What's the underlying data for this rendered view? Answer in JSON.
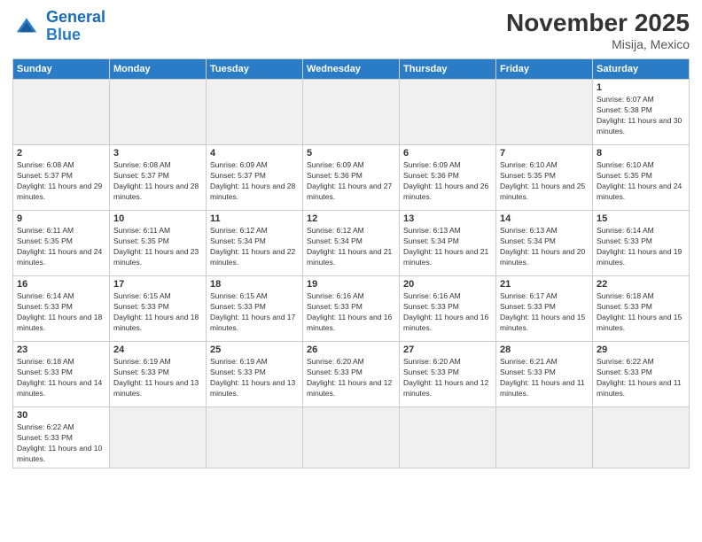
{
  "logo": {
    "text_general": "General",
    "text_blue": "Blue"
  },
  "header": {
    "month_year": "November 2025",
    "location": "Misija, Mexico"
  },
  "weekdays": [
    "Sunday",
    "Monday",
    "Tuesday",
    "Wednesday",
    "Thursday",
    "Friday",
    "Saturday"
  ],
  "weeks": [
    [
      {
        "day": "",
        "empty": true
      },
      {
        "day": "",
        "empty": true
      },
      {
        "day": "",
        "empty": true
      },
      {
        "day": "",
        "empty": true
      },
      {
        "day": "",
        "empty": true
      },
      {
        "day": "",
        "empty": true
      },
      {
        "day": "1",
        "sunrise": "Sunrise: 6:07 AM",
        "sunset": "Sunset: 5:38 PM",
        "daylight": "Daylight: 11 hours and 30 minutes."
      }
    ],
    [
      {
        "day": "2",
        "sunrise": "Sunrise: 6:08 AM",
        "sunset": "Sunset: 5:37 PM",
        "daylight": "Daylight: 11 hours and 29 minutes."
      },
      {
        "day": "3",
        "sunrise": "Sunrise: 6:08 AM",
        "sunset": "Sunset: 5:37 PM",
        "daylight": "Daylight: 11 hours and 28 minutes."
      },
      {
        "day": "4",
        "sunrise": "Sunrise: 6:09 AM",
        "sunset": "Sunset: 5:37 PM",
        "daylight": "Daylight: 11 hours and 28 minutes."
      },
      {
        "day": "5",
        "sunrise": "Sunrise: 6:09 AM",
        "sunset": "Sunset: 5:36 PM",
        "daylight": "Daylight: 11 hours and 27 minutes."
      },
      {
        "day": "6",
        "sunrise": "Sunrise: 6:09 AM",
        "sunset": "Sunset: 5:36 PM",
        "daylight": "Daylight: 11 hours and 26 minutes."
      },
      {
        "day": "7",
        "sunrise": "Sunrise: 6:10 AM",
        "sunset": "Sunset: 5:35 PM",
        "daylight": "Daylight: 11 hours and 25 minutes."
      },
      {
        "day": "8",
        "sunrise": "Sunrise: 6:10 AM",
        "sunset": "Sunset: 5:35 PM",
        "daylight": "Daylight: 11 hours and 24 minutes."
      }
    ],
    [
      {
        "day": "9",
        "sunrise": "Sunrise: 6:11 AM",
        "sunset": "Sunset: 5:35 PM",
        "daylight": "Daylight: 11 hours and 24 minutes."
      },
      {
        "day": "10",
        "sunrise": "Sunrise: 6:11 AM",
        "sunset": "Sunset: 5:35 PM",
        "daylight": "Daylight: 11 hours and 23 minutes."
      },
      {
        "day": "11",
        "sunrise": "Sunrise: 6:12 AM",
        "sunset": "Sunset: 5:34 PM",
        "daylight": "Daylight: 11 hours and 22 minutes."
      },
      {
        "day": "12",
        "sunrise": "Sunrise: 6:12 AM",
        "sunset": "Sunset: 5:34 PM",
        "daylight": "Daylight: 11 hours and 21 minutes."
      },
      {
        "day": "13",
        "sunrise": "Sunrise: 6:13 AM",
        "sunset": "Sunset: 5:34 PM",
        "daylight": "Daylight: 11 hours and 21 minutes."
      },
      {
        "day": "14",
        "sunrise": "Sunrise: 6:13 AM",
        "sunset": "Sunset: 5:34 PM",
        "daylight": "Daylight: 11 hours and 20 minutes."
      },
      {
        "day": "15",
        "sunrise": "Sunrise: 6:14 AM",
        "sunset": "Sunset: 5:33 PM",
        "daylight": "Daylight: 11 hours and 19 minutes."
      }
    ],
    [
      {
        "day": "16",
        "sunrise": "Sunrise: 6:14 AM",
        "sunset": "Sunset: 5:33 PM",
        "daylight": "Daylight: 11 hours and 18 minutes."
      },
      {
        "day": "17",
        "sunrise": "Sunrise: 6:15 AM",
        "sunset": "Sunset: 5:33 PM",
        "daylight": "Daylight: 11 hours and 18 minutes."
      },
      {
        "day": "18",
        "sunrise": "Sunrise: 6:15 AM",
        "sunset": "Sunset: 5:33 PM",
        "daylight": "Daylight: 11 hours and 17 minutes."
      },
      {
        "day": "19",
        "sunrise": "Sunrise: 6:16 AM",
        "sunset": "Sunset: 5:33 PM",
        "daylight": "Daylight: 11 hours and 16 minutes."
      },
      {
        "day": "20",
        "sunrise": "Sunrise: 6:16 AM",
        "sunset": "Sunset: 5:33 PM",
        "daylight": "Daylight: 11 hours and 16 minutes."
      },
      {
        "day": "21",
        "sunrise": "Sunrise: 6:17 AM",
        "sunset": "Sunset: 5:33 PM",
        "daylight": "Daylight: 11 hours and 15 minutes."
      },
      {
        "day": "22",
        "sunrise": "Sunrise: 6:18 AM",
        "sunset": "Sunset: 5:33 PM",
        "daylight": "Daylight: 11 hours and 15 minutes."
      }
    ],
    [
      {
        "day": "23",
        "sunrise": "Sunrise: 6:18 AM",
        "sunset": "Sunset: 5:33 PM",
        "daylight": "Daylight: 11 hours and 14 minutes."
      },
      {
        "day": "24",
        "sunrise": "Sunrise: 6:19 AM",
        "sunset": "Sunset: 5:33 PM",
        "daylight": "Daylight: 11 hours and 13 minutes."
      },
      {
        "day": "25",
        "sunrise": "Sunrise: 6:19 AM",
        "sunset": "Sunset: 5:33 PM",
        "daylight": "Daylight: 11 hours and 13 minutes."
      },
      {
        "day": "26",
        "sunrise": "Sunrise: 6:20 AM",
        "sunset": "Sunset: 5:33 PM",
        "daylight": "Daylight: 11 hours and 12 minutes."
      },
      {
        "day": "27",
        "sunrise": "Sunrise: 6:20 AM",
        "sunset": "Sunset: 5:33 PM",
        "daylight": "Daylight: 11 hours and 12 minutes."
      },
      {
        "day": "28",
        "sunrise": "Sunrise: 6:21 AM",
        "sunset": "Sunset: 5:33 PM",
        "daylight": "Daylight: 11 hours and 11 minutes."
      },
      {
        "day": "29",
        "sunrise": "Sunrise: 6:22 AM",
        "sunset": "Sunset: 5:33 PM",
        "daylight": "Daylight: 11 hours and 11 minutes."
      }
    ],
    [
      {
        "day": "30",
        "sunrise": "Sunrise: 6:22 AM",
        "sunset": "Sunset: 5:33 PM",
        "daylight": "Daylight: 11 hours and 10 minutes."
      },
      {
        "day": "",
        "empty": true
      },
      {
        "day": "",
        "empty": true
      },
      {
        "day": "",
        "empty": true
      },
      {
        "day": "",
        "empty": true
      },
      {
        "day": "",
        "empty": true
      },
      {
        "day": "",
        "empty": true
      }
    ]
  ]
}
